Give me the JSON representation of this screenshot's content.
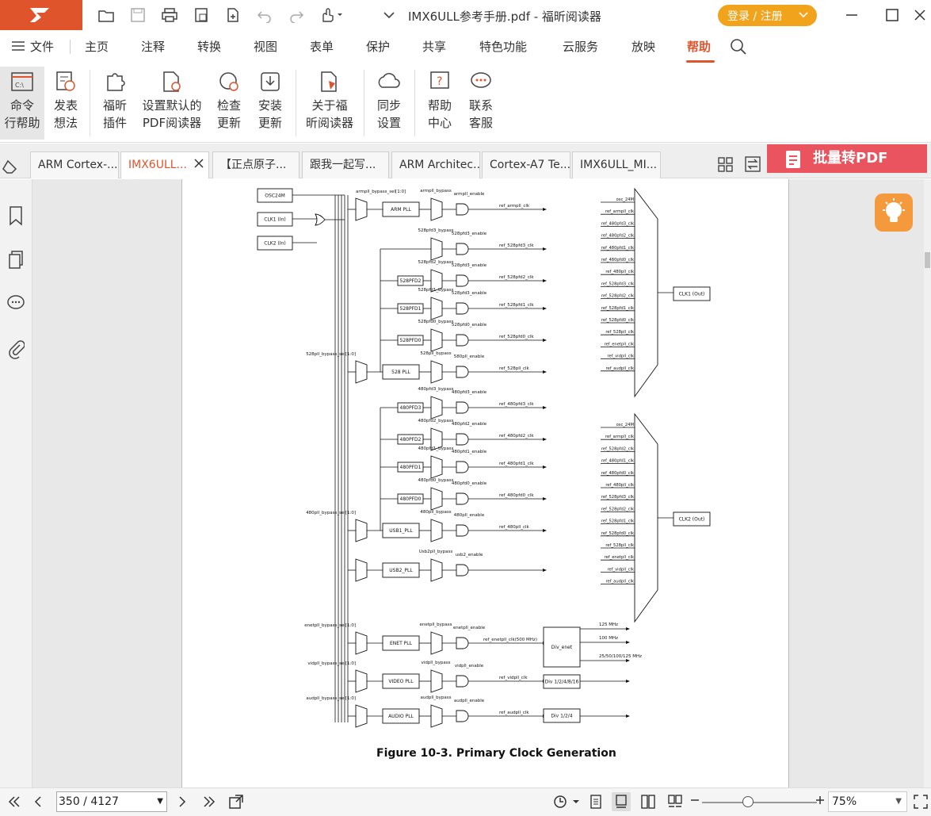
{
  "title_bar": {
    "doc_title": "IMX6ULL参考手册.pdf - 福昕阅读器",
    "login_label": "登录 / 注册"
  },
  "menu": {
    "file": "文件",
    "items": [
      "主页",
      "注释",
      "转换",
      "视图",
      "表单",
      "保护",
      "共享",
      "特色功能",
      "云服务",
      "放映",
      "帮助"
    ],
    "active": "帮助"
  },
  "ribbon": {
    "buttons": [
      {
        "line1": "命令",
        "line2": "行帮助",
        "icon": "command-line-icon"
      },
      {
        "line1": "发表",
        "line2": "想法",
        "icon": "feedback-icon"
      },
      {
        "line1": "福昕",
        "line2": "插件",
        "icon": "plugin-icon"
      },
      {
        "line1": "设置默认的",
        "line2": "PDF阅读器",
        "icon": "default-reader-icon"
      },
      {
        "line1": "检查",
        "line2": "更新",
        "icon": "check-update-icon"
      },
      {
        "line1": "安装",
        "line2": "更新",
        "icon": "install-update-icon"
      },
      {
        "line1": "关于福",
        "line2": "昕阅读器",
        "icon": "about-icon"
      },
      {
        "line1": "同步",
        "line2": "设置",
        "icon": "sync-icon"
      },
      {
        "line1": "帮助",
        "line2": "中心",
        "icon": "help-center-icon"
      },
      {
        "line1": "联系",
        "line2": "客服",
        "icon": "contact-support-icon"
      }
    ]
  },
  "tabs": [
    {
      "label": "ARM Cortex-..."
    },
    {
      "label": "IMX6ULL...",
      "active": true
    },
    {
      "label": "【正点原子..."
    },
    {
      "label": "跟我一起写..."
    },
    {
      "label": "ARM Architec..."
    },
    {
      "label": "Cortex-A7 Te..."
    },
    {
      "label": "IMX6ULL_MI..."
    }
  ],
  "batch_convert_label": "批量转PDF",
  "diagram": {
    "sources": [
      "OSC24M",
      "CLK1 (In)",
      "CLK2 (In)"
    ],
    "sel_labels": [
      "armpll_bypass_sel[1:0]",
      "528pll_bypass_sel[1:0]",
      "480pll_bypass_sel[1:0]",
      "enetpll_bypass_sel[1:0]",
      "vidpll_bypass_sel[1:0]",
      "audpll_bypass_sel[1:0]"
    ],
    "blocks": [
      "ARM PLL",
      "528PFD2",
      "528PFD1",
      "528PFD0",
      "528 PLL",
      "480PFD3",
      "480PFD2",
      "480PFD1",
      "480PFD0",
      "USB1_PLL",
      "USB2_PLL",
      "ENET PLL",
      "VIDEO PLL",
      "AUDIO PLL",
      "Div_enet",
      "Div 1/2/4/8/16",
      "Div 1/2/4"
    ],
    "outputs_1": [
      "osc_24M",
      "ref_armpll_clk",
      "ref_480pfd3_clk",
      "ref_480pfd2_clk",
      "ref_480pfd1_clk",
      "ref_480pfd0_clk",
      "ref_480pll_clk",
      "ref_528pfd3_clk",
      "ref_528pfd2_clk",
      "ref_528pfd1_clk",
      "ref_528pfd0_clk",
      "ref_528pll_clk",
      "ref_enetpll_clk",
      "ref_vidpll_clk",
      "ref_audpll_clk"
    ],
    "outputs_2": [
      "osc_24M",
      "ref_armpll_clk",
      "ref_528pfd2_clk",
      "ref_480pfd1_clk",
      "ref_480pfd0_clk",
      "ref_480pll_clk",
      "ref_528pfd3_clk",
      "ref_528pfd2_clk",
      "ref_528pfd1_clk",
      "ref_528pfd0_clk",
      "ref_528pll_clk",
      "ref_enetpll_clk",
      "ref_vidpll_clk",
      "ref_audpll_clk"
    ],
    "clk_out": [
      "CLK1 (Out)",
      "CLK2 (Out)"
    ],
    "rows": [
      {
        "bypass": "armpll_bypass",
        "enable": "armpll_enable",
        "out": "ref_armpll_clk"
      },
      {
        "bypass": "528pfd3_bypass",
        "enable": "528pfd3_enable",
        "out": "ref_528pfd3_clk"
      },
      {
        "bypass": "528pfd2_bypass",
        "enable": "528pfd3_enable",
        "out": "ref_528pfd2_clk"
      },
      {
        "bypass": "528pfd1_bypass",
        "enable": "528pfd3_enable",
        "out": "ref_528pfd1_clk"
      },
      {
        "bypass": "528pfd0_bypass",
        "enable": "528pfd0_enable",
        "out": "ref_528pfd0_clk"
      },
      {
        "bypass": "528pll_bypass",
        "enable": "580pll_enable",
        "out": "ref_528pll_clk"
      },
      {
        "bypass": "480pfd3_bypass",
        "enable": "480pfd3_enable",
        "out": "ref_480pfd3_clk"
      },
      {
        "bypass": "480pfd2_bypass",
        "enable": "480pfd2_enable",
        "out": "ref_480pfd2_clk"
      },
      {
        "bypass": "480pfd1_bypass",
        "enable": "480pfd1_enable",
        "out": "ref_480pfd1_clk"
      },
      {
        "bypass": "480pfd0_bypass",
        "enable": "480pfd0_enable",
        "out": "ref_480pfd0_clk"
      },
      {
        "bypass": "480pll_bypass",
        "enable": "480pll_enable",
        "out": "ref_480pll_clk"
      },
      {
        "bypass": "Usb2pll_bypass",
        "enable": "usb2_enable",
        "out": ""
      },
      {
        "bypass": "enetpll_bypass",
        "enable": "enetpll_enable",
        "out": "ref_enetpll_clk(500 MHz)"
      },
      {
        "bypass": "vidpll_bypass",
        "enable": "vidpll_enable",
        "out": "ref_vidpll_clk"
      },
      {
        "bypass": "audpll_bypass",
        "enable": "audpll_enable",
        "out": "ref_audpll_clk"
      }
    ],
    "enet_outputs": [
      "125 MHz",
      "100 MHz",
      "25/50/100/125 MHz"
    ]
  },
  "figure_caption": "Figure 10-3. Primary Clock Generation",
  "status": {
    "page_display": "350 / 4127",
    "zoom": "75%",
    "zoom_level": 0.4
  }
}
